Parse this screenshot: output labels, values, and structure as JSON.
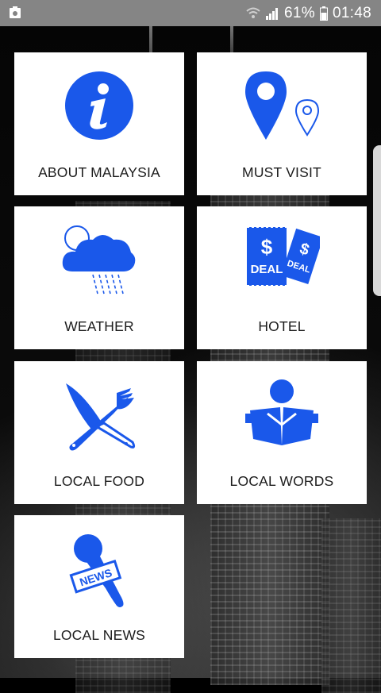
{
  "status_bar": {
    "battery_percent": "61%",
    "time": "01:48"
  },
  "accent_color": "#1a58ea",
  "tiles": [
    {
      "label": "ABOUT MALAYSIA",
      "icon": "info-icon"
    },
    {
      "label": "MUST VISIT",
      "icon": "map-pin-icon"
    },
    {
      "label": "WEATHER",
      "icon": "rain-cloud-icon"
    },
    {
      "label": "HOTEL",
      "icon": "deal-ticket-icon"
    },
    {
      "label": "LOCAL FOOD",
      "icon": "knife-fork-icon"
    },
    {
      "label": "LOCAL WORDS",
      "icon": "reading-book-icon"
    },
    {
      "label": "LOCAL NEWS",
      "icon": "news-microphone-icon"
    }
  ],
  "news_badge": "NEWS",
  "deal_badge": "DEAL"
}
